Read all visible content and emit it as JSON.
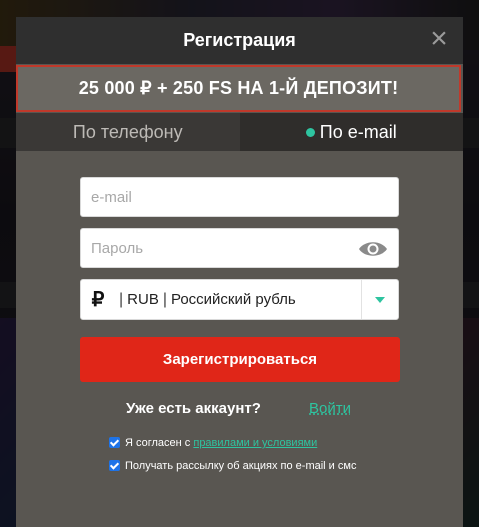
{
  "modal": {
    "title": "Регистрация",
    "close_glyph": "×",
    "bonus_banner": "25 000 ₽ + 250 FS НА 1-Й ДЕПОЗИТ!"
  },
  "tabs": [
    {
      "label": "По телефону",
      "active": false
    },
    {
      "label": "По e-mail",
      "active": true
    }
  ],
  "form": {
    "email_placeholder": "e-mail",
    "email_value": "",
    "password_placeholder": "Пароль",
    "password_value": "",
    "currency": {
      "symbol": "₽",
      "code": "RUB",
      "name": "Российский рубль"
    },
    "submit_label": "Зарегистрироваться"
  },
  "login": {
    "question": "Уже есть аккаунт?",
    "link": "Войти"
  },
  "consents": {
    "terms_prefix": "Я согласен с ",
    "terms_link": "правилами и условиями",
    "newsletter": "Получать рассылку об акциях по e-mail и смс"
  },
  "colors": {
    "accent": "#2ec4a0",
    "primary_button": "#e02618",
    "banner_border": "#c0392b",
    "modal_bg": "#595651",
    "header_bg": "#2f2f2f"
  },
  "icons": [
    "close-icon",
    "eye-icon",
    "ruble-icon",
    "chevron-down-icon",
    "checkbox-checked-icon"
  ]
}
